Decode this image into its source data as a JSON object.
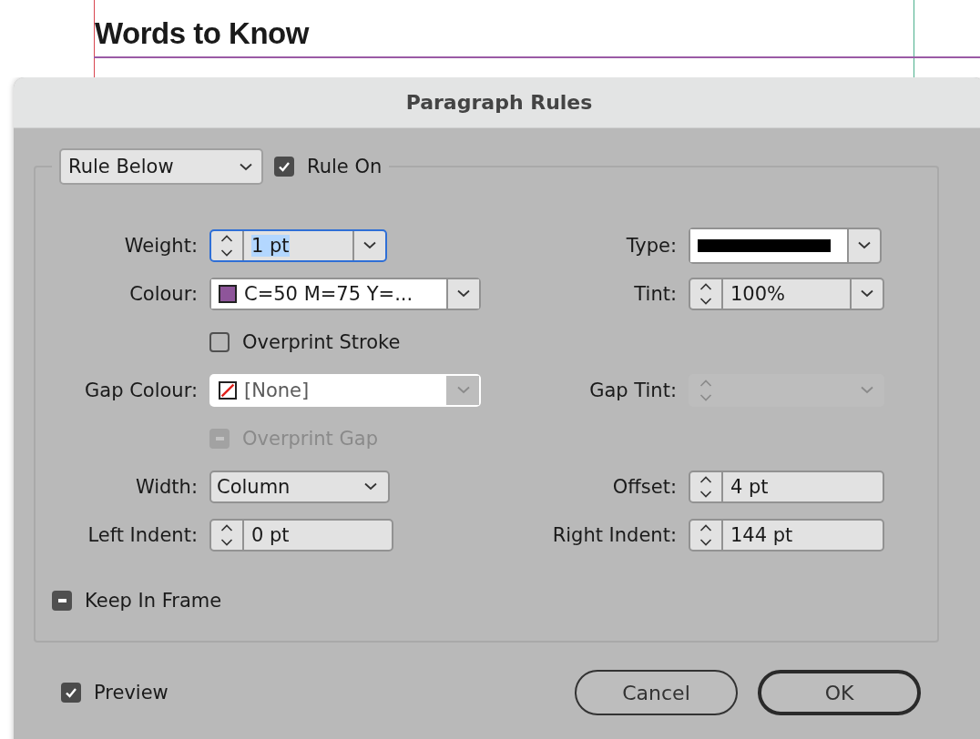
{
  "document": {
    "heading": "Words to Know"
  },
  "dialog": {
    "title": "Paragraph Rules",
    "rule_select": {
      "value": "Rule Below"
    },
    "rule_on": {
      "label": "Rule On",
      "checked": true
    },
    "rows": [
      {
        "left": {
          "kind": "combo",
          "label": "Weight:",
          "value": "1 pt",
          "focused": true
        },
        "right": {
          "kind": "stroke",
          "label": "Type:"
        }
      },
      {
        "left": {
          "kind": "swatch",
          "label": "Colour:",
          "value": "C=50 M=75 Y=...",
          "color": "#8e559a",
          "disabled": false
        },
        "right": {
          "kind": "combo",
          "label": "Tint:",
          "value": "100%",
          "focused": false
        }
      },
      {
        "left": {
          "kind": "checkbox",
          "label": "Overprint Stroke",
          "checked": false,
          "disabled": false
        }
      },
      {
        "left": {
          "kind": "swatch",
          "label": "Gap Colour:",
          "value": "[None]",
          "disabled": true
        },
        "right": {
          "kind": "combo",
          "label": "Gap Tint:",
          "disabled": true
        }
      },
      {
        "left": {
          "kind": "checkbox",
          "label": "Overprint Gap",
          "mixed": true,
          "disabled": true
        }
      },
      {
        "left": {
          "kind": "select",
          "label": "Width:",
          "value": "Column"
        },
        "right": {
          "kind": "spinner",
          "label": "Offset:",
          "value": "4 pt"
        }
      },
      {
        "left": {
          "kind": "spinner",
          "label": "Left Indent:",
          "value": "0 pt"
        },
        "right": {
          "kind": "spinner",
          "label": "Right Indent:",
          "value": "144 pt"
        }
      }
    ],
    "keep_in_frame": {
      "label": "Keep In Frame",
      "mixed": true
    },
    "preview": {
      "label": "Preview",
      "checked": true
    },
    "buttons": [
      {
        "label": "Cancel",
        "default": false
      },
      {
        "label": "OK",
        "default": true
      }
    ]
  }
}
